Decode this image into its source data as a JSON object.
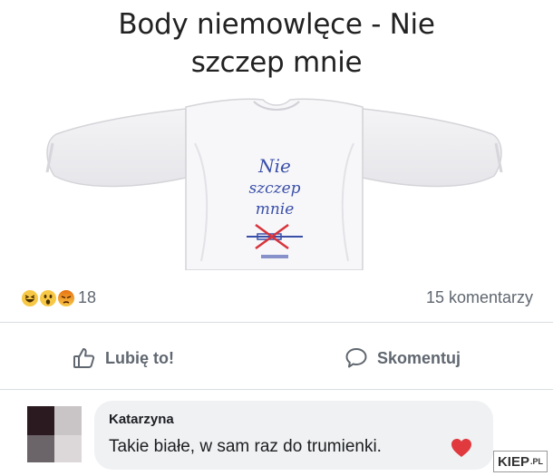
{
  "post": {
    "title_line1": "Body niemowlęce - Nie",
    "title_line2": "szczep mnie"
  },
  "product": {
    "print_line1": "Nie",
    "print_line2": "szczep",
    "print_line3": "mnie"
  },
  "reactions": {
    "icons": [
      "haha-icon",
      "wow-icon",
      "angry-icon"
    ],
    "count": "18",
    "comments_count": "15 komentarzy"
  },
  "actions": {
    "like_label": "Lubię to!",
    "comment_label": "Skomentuj"
  },
  "comment": {
    "author": "Katarzyna",
    "text": "Takie białe, w sam raz do trumienki.",
    "reaction_icon": "heart-icon"
  },
  "watermark": {
    "text": "KIEP",
    "suffix": ".PL"
  },
  "colors": {
    "text_secondary": "#606770",
    "bubble": "#eff1f3",
    "print_blue": "#3a4fa8",
    "print_red": "#d8323a",
    "heart": "#e0393e"
  }
}
